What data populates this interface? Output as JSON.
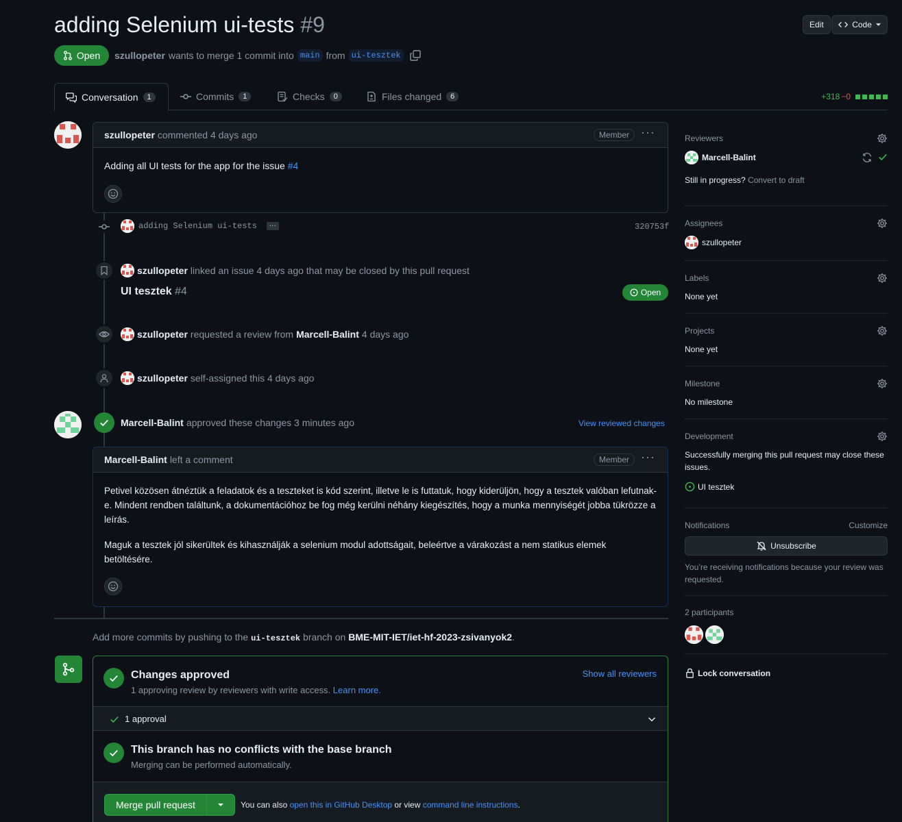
{
  "header": {
    "title": "adding Selenium ui-tests",
    "number": "#9",
    "edit_label": "Edit",
    "code_label": "Code",
    "state": "Open",
    "author": "szullopeter",
    "merge_text": "wants to merge 1 commit into",
    "base_branch": "main",
    "from_text": "from",
    "head_branch": "ui-tesztek"
  },
  "tabs": [
    {
      "label": "Conversation",
      "count": "1"
    },
    {
      "label": "Commits",
      "count": "1"
    },
    {
      "label": "Checks",
      "count": "0"
    },
    {
      "label": "Files changed",
      "count": "6"
    }
  ],
  "diffstat": {
    "additions": "+318",
    "deletions": "−0"
  },
  "timeline": {
    "first_comment": {
      "author": "szullopeter",
      "action": "commented 4 days ago",
      "badge": "Member",
      "body_prefix": "Adding all UI tests for the app for the issue",
      "issue_link": "#4"
    },
    "commit": {
      "message": "adding Selenium ui-tests",
      "sha": "320753f"
    },
    "linked": {
      "author": "szullopeter",
      "text": "linked an issue 4 days ago that may be closed by this pull request",
      "issue_title": "UI tesztek",
      "issue_number": "#4",
      "issue_state": "Open"
    },
    "review_request": {
      "author": "szullopeter",
      "text": "requested a review from",
      "reviewer": "Marcell-Balint",
      "time": "4 days ago"
    },
    "self_assign": {
      "author": "szullopeter",
      "text": "self-assigned this 4 days ago"
    },
    "approval": {
      "author": "Marcell-Balint",
      "text": "approved these changes 3 minutes ago",
      "view_link": "View reviewed changes"
    },
    "review_comment": {
      "author": "Marcell-Balint",
      "action": "left a comment",
      "badge": "Member",
      "paragraph1": "Petivel közösen átnéztük a feladatok és a teszteket is kód szerint, illetve le is futtatuk, hogy kiderüljön, hogy a tesztek valóban lefutnak-e. Mindent rendben találtunk, a dokumentációhoz be fog még kerülni néhány kiegészítés, hogy a munka mennyiségét jobba tükrözze a leírás.",
      "paragraph2": "Maguk a tesztek jól sikerültek és kihasználják a selenium modul adottságait, beleértve a várakozást a nem statikus elemek betöltésére."
    }
  },
  "push_hint": {
    "prefix": "Add more commits by pushing to the",
    "branch": "ui-tesztek",
    "middle": "branch on",
    "repo": "BME-MIT-IET/iet-hf-2023-zsivanyok2",
    "suffix": "."
  },
  "merge": {
    "approved_title": "Changes approved",
    "approved_sub": "1 approving review by reviewers with write access.",
    "learn_more": "Learn more.",
    "show_reviewers": "Show all reviewers",
    "approval_count": "1 approval",
    "conflict_title": "This branch has no conflicts with the base branch",
    "conflict_sub": "Merging can be performed automatically.",
    "merge_button": "Merge pull request",
    "also_text": "You can also",
    "desktop_link": "open this in GitHub Desktop",
    "or_view": "or view",
    "cli_link": "command line instructions",
    "end": "."
  },
  "sidebar": {
    "reviewers_label": "Reviewers",
    "reviewer": "Marcell-Balint",
    "draft_prefix": "Still in progress?",
    "draft_link": "Convert to draft",
    "assignees_label": "Assignees",
    "assignee": "szullopeter",
    "labels_label": "Labels",
    "labels_value": "None yet",
    "projects_label": "Projects",
    "projects_value": "None yet",
    "milestone_label": "Milestone",
    "milestone_value": "No milestone",
    "development_label": "Development",
    "development_text": "Successfully merging this pull request may close these issues.",
    "development_issue": "UI tesztek",
    "notifications_label": "Notifications",
    "customize_label": "Customize",
    "unsubscribe_label": "Unsubscribe",
    "notification_reason": "You’re receiving notifications because your review was requested.",
    "participants_label": "2 participants",
    "lock_label": "Lock conversation"
  },
  "colors": {
    "green": "#238636",
    "link": "#4493f8",
    "bg": "#0d1117"
  }
}
